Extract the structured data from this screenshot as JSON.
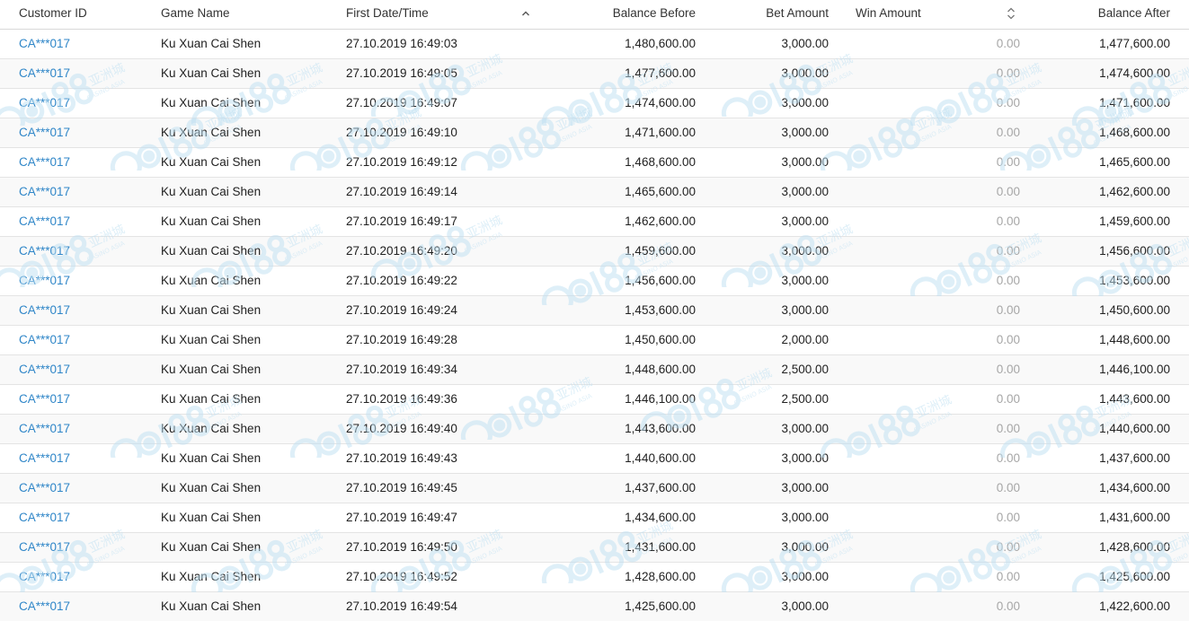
{
  "columns": {
    "customer_id": "Customer ID",
    "game_name": "Game Name",
    "first_datetime": "First Date/Time",
    "balance_before": "Balance Before",
    "bet_amount": "Bet Amount",
    "win_amount": "Win Amount",
    "balance_after": "Balance After"
  },
  "sort": {
    "active_column": "first_datetime",
    "direction": "ascending"
  },
  "colors": {
    "link": "#2f86c8",
    "muted_value": "#a6a6a6",
    "row_alt": "#f9f9f9",
    "watermark": "#bfe0f2"
  },
  "rows": [
    {
      "customer_id": "CA***017",
      "game_name": "Ku Xuan Cai Shen",
      "first_datetime": "27.10.2019 16:49:03",
      "balance_before": "1,480,600.00",
      "bet_amount": "3,000.00",
      "win_amount": "0.00",
      "balance_after": "1,477,600.00"
    },
    {
      "customer_id": "CA***017",
      "game_name": "Ku Xuan Cai Shen",
      "first_datetime": "27.10.2019 16:49:05",
      "balance_before": "1,477,600.00",
      "bet_amount": "3,000.00",
      "win_amount": "0.00",
      "balance_after": "1,474,600.00"
    },
    {
      "customer_id": "CA***017",
      "game_name": "Ku Xuan Cai Shen",
      "first_datetime": "27.10.2019 16:49:07",
      "balance_before": "1,474,600.00",
      "bet_amount": "3,000.00",
      "win_amount": "0.00",
      "balance_after": "1,471,600.00"
    },
    {
      "customer_id": "CA***017",
      "game_name": "Ku Xuan Cai Shen",
      "first_datetime": "27.10.2019 16:49:10",
      "balance_before": "1,471,600.00",
      "bet_amount": "3,000.00",
      "win_amount": "0.00",
      "balance_after": "1,468,600.00"
    },
    {
      "customer_id": "CA***017",
      "game_name": "Ku Xuan Cai Shen",
      "first_datetime": "27.10.2019 16:49:12",
      "balance_before": "1,468,600.00",
      "bet_amount": "3,000.00",
      "win_amount": "0.00",
      "balance_after": "1,465,600.00"
    },
    {
      "customer_id": "CA***017",
      "game_name": "Ku Xuan Cai Shen",
      "first_datetime": "27.10.2019 16:49:14",
      "balance_before": "1,465,600.00",
      "bet_amount": "3,000.00",
      "win_amount": "0.00",
      "balance_after": "1,462,600.00"
    },
    {
      "customer_id": "CA***017",
      "game_name": "Ku Xuan Cai Shen",
      "first_datetime": "27.10.2019 16:49:17",
      "balance_before": "1,462,600.00",
      "bet_amount": "3,000.00",
      "win_amount": "0.00",
      "balance_after": "1,459,600.00"
    },
    {
      "customer_id": "CA***017",
      "game_name": "Ku Xuan Cai Shen",
      "first_datetime": "27.10.2019 16:49:20",
      "balance_before": "1,459,600.00",
      "bet_amount": "3,000.00",
      "win_amount": "0.00",
      "balance_after": "1,456,600.00"
    },
    {
      "customer_id": "CA***017",
      "game_name": "Ku Xuan Cai Shen",
      "first_datetime": "27.10.2019 16:49:22",
      "balance_before": "1,456,600.00",
      "bet_amount": "3,000.00",
      "win_amount": "0.00",
      "balance_after": "1,453,600.00"
    },
    {
      "customer_id": "CA***017",
      "game_name": "Ku Xuan Cai Shen",
      "first_datetime": "27.10.2019 16:49:24",
      "balance_before": "1,453,600.00",
      "bet_amount": "3,000.00",
      "win_amount": "0.00",
      "balance_after": "1,450,600.00"
    },
    {
      "customer_id": "CA***017",
      "game_name": "Ku Xuan Cai Shen",
      "first_datetime": "27.10.2019 16:49:28",
      "balance_before": "1,450,600.00",
      "bet_amount": "2,000.00",
      "win_amount": "0.00",
      "balance_after": "1,448,600.00"
    },
    {
      "customer_id": "CA***017",
      "game_name": "Ku Xuan Cai Shen",
      "first_datetime": "27.10.2019 16:49:34",
      "balance_before": "1,448,600.00",
      "bet_amount": "2,500.00",
      "win_amount": "0.00",
      "balance_after": "1,446,100.00"
    },
    {
      "customer_id": "CA***017",
      "game_name": "Ku Xuan Cai Shen",
      "first_datetime": "27.10.2019 16:49:36",
      "balance_before": "1,446,100.00",
      "bet_amount": "2,500.00",
      "win_amount": "0.00",
      "balance_after": "1,443,600.00"
    },
    {
      "customer_id": "CA***017",
      "game_name": "Ku Xuan Cai Shen",
      "first_datetime": "27.10.2019 16:49:40",
      "balance_before": "1,443,600.00",
      "bet_amount": "3,000.00",
      "win_amount": "0.00",
      "balance_after": "1,440,600.00"
    },
    {
      "customer_id": "CA***017",
      "game_name": "Ku Xuan Cai Shen",
      "first_datetime": "27.10.2019 16:49:43",
      "balance_before": "1,440,600.00",
      "bet_amount": "3,000.00",
      "win_amount": "0.00",
      "balance_after": "1,437,600.00"
    },
    {
      "customer_id": "CA***017",
      "game_name": "Ku Xuan Cai Shen",
      "first_datetime": "27.10.2019 16:49:45",
      "balance_before": "1,437,600.00",
      "bet_amount": "3,000.00",
      "win_amount": "0.00",
      "balance_after": "1,434,600.00"
    },
    {
      "customer_id": "CA***017",
      "game_name": "Ku Xuan Cai Shen",
      "first_datetime": "27.10.2019 16:49:47",
      "balance_before": "1,434,600.00",
      "bet_amount": "3,000.00",
      "win_amount": "0.00",
      "balance_after": "1,431,600.00"
    },
    {
      "customer_id": "CA***017",
      "game_name": "Ku Xuan Cai Shen",
      "first_datetime": "27.10.2019 16:49:50",
      "balance_before": "1,431,600.00",
      "bet_amount": "3,000.00",
      "win_amount": "0.00",
      "balance_after": "1,428,600.00"
    },
    {
      "customer_id": "CA***017",
      "game_name": "Ku Xuan Cai Shen",
      "first_datetime": "27.10.2019 16:49:52",
      "balance_before": "1,428,600.00",
      "bet_amount": "3,000.00",
      "win_amount": "0.00",
      "balance_after": "1,425,600.00"
    },
    {
      "customer_id": "CA***017",
      "game_name": "Ku Xuan Cai Shen",
      "first_datetime": "27.10.2019 16:49:54",
      "balance_before": "1,425,600.00",
      "bet_amount": "3,000.00",
      "win_amount": "0.00",
      "balance_after": "1,422,600.00"
    }
  ],
  "watermark": {
    "logo_text": "C 188",
    "chinese_text": "亚洲城",
    "english_text": "CASINO ASIA"
  }
}
